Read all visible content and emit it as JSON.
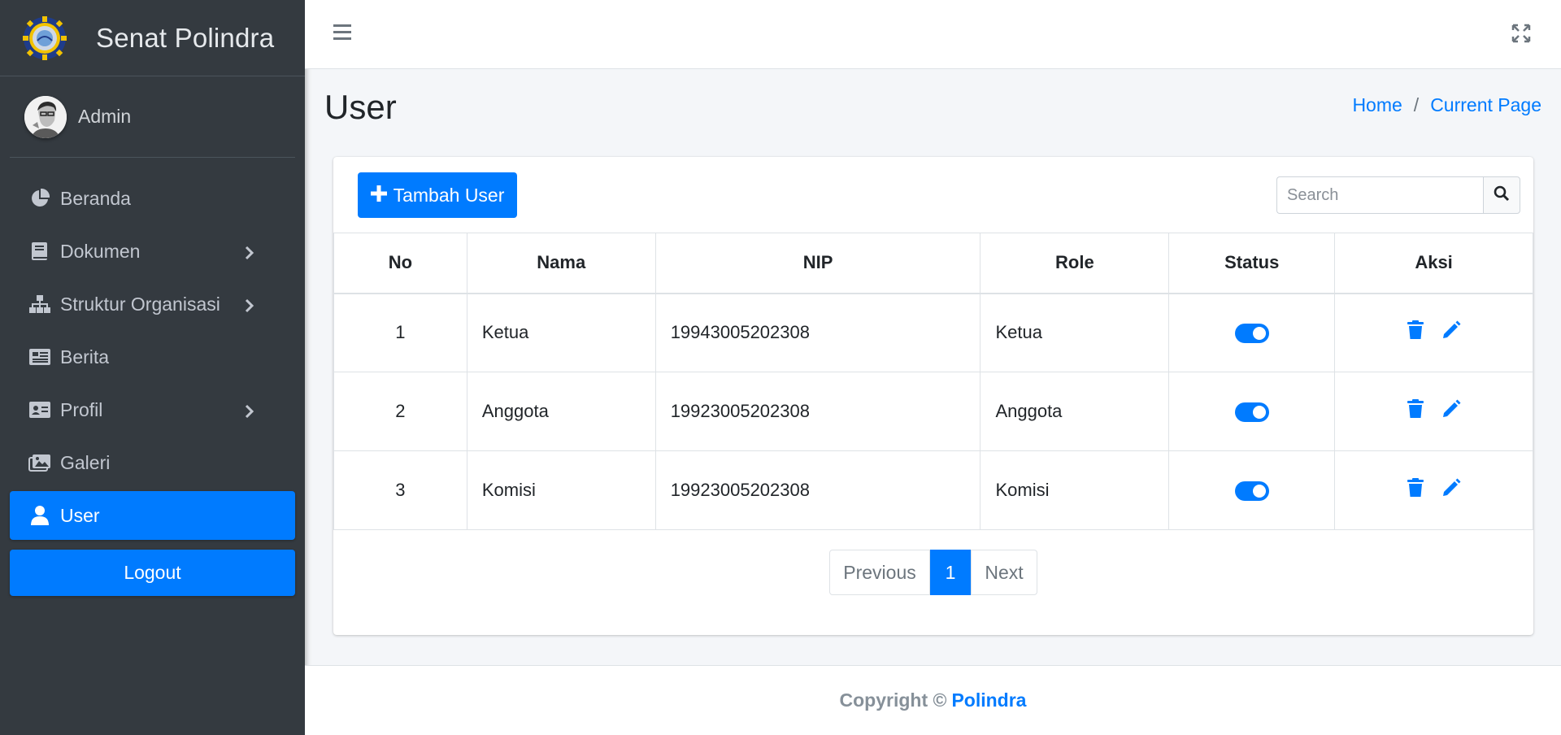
{
  "sidebar": {
    "brand": "Senat Polindra",
    "user_name": "Admin",
    "items": [
      {
        "label": "Beranda",
        "icon": "chart-pie-icon"
      },
      {
        "label": "Dokumen",
        "icon": "book-icon"
      },
      {
        "label": "Struktur Organisasi",
        "icon": "sitemap-icon"
      },
      {
        "label": "Berita",
        "icon": "newspaper-icon"
      },
      {
        "label": "Profil",
        "icon": "id-card-icon"
      },
      {
        "label": "Galeri",
        "icon": "images-icon"
      },
      {
        "label": "User",
        "icon": "user-icon"
      }
    ],
    "logout_label": "Logout"
  },
  "header": {
    "title": "User",
    "breadcrumb": {
      "home": "Home",
      "separator": "/",
      "current": "Current Page"
    }
  },
  "toolbar": {
    "add_label": "Tambah User",
    "search_placeholder": "Search"
  },
  "table": {
    "columns": [
      "No",
      "Nama",
      "NIP",
      "Role",
      "Status",
      "Aksi"
    ],
    "rows": [
      {
        "no": "1",
        "nama": "Ketua",
        "nip": "19943005202308",
        "role": "Ketua",
        "status": true
      },
      {
        "no": "2",
        "nama": "Anggota",
        "nip": "19923005202308",
        "role": "Anggota",
        "status": true
      },
      {
        "no": "3",
        "nama": "Komisi",
        "nip": "19923005202308",
        "role": "Komisi",
        "status": true
      }
    ]
  },
  "pagination": {
    "previous": "Previous",
    "current": "1",
    "next": "Next"
  },
  "footer": {
    "copyright": "Copyright ©",
    "brand": "Polindra"
  },
  "colors": {
    "primary": "#007bff",
    "sidebar": "#343a40"
  }
}
